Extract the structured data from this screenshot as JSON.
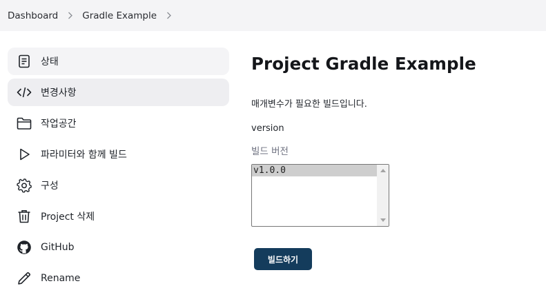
{
  "breadcrumb": {
    "items": [
      "Dashboard",
      "Gradle Example"
    ]
  },
  "sidebar": {
    "items": [
      {
        "label": "상태",
        "icon": "document-icon"
      },
      {
        "label": "변경사항",
        "icon": "code-icon"
      },
      {
        "label": "작업공간",
        "icon": "folder-icon"
      },
      {
        "label": "파라미터와 함께 빌드",
        "icon": "play-icon"
      },
      {
        "label": "구성",
        "icon": "gear-icon"
      },
      {
        "label": "Project 삭제",
        "icon": "trash-icon"
      },
      {
        "label": "GitHub",
        "icon": "github-icon"
      },
      {
        "label": "Rename",
        "icon": "pencil-icon"
      }
    ]
  },
  "main": {
    "title": "Project Gradle Example",
    "description": "매개변수가 필요한 빌드입니다.",
    "parameter": {
      "name": "version",
      "description": "빌드 버전",
      "options": [
        "v1.0.0"
      ],
      "selected": "v1.0.0"
    },
    "build_button_label": "빌드하기"
  },
  "colors": {
    "accent_button": "#143c5c",
    "breadcrumb_bg": "#f4f4f6",
    "param_desc": "#6e7180"
  }
}
